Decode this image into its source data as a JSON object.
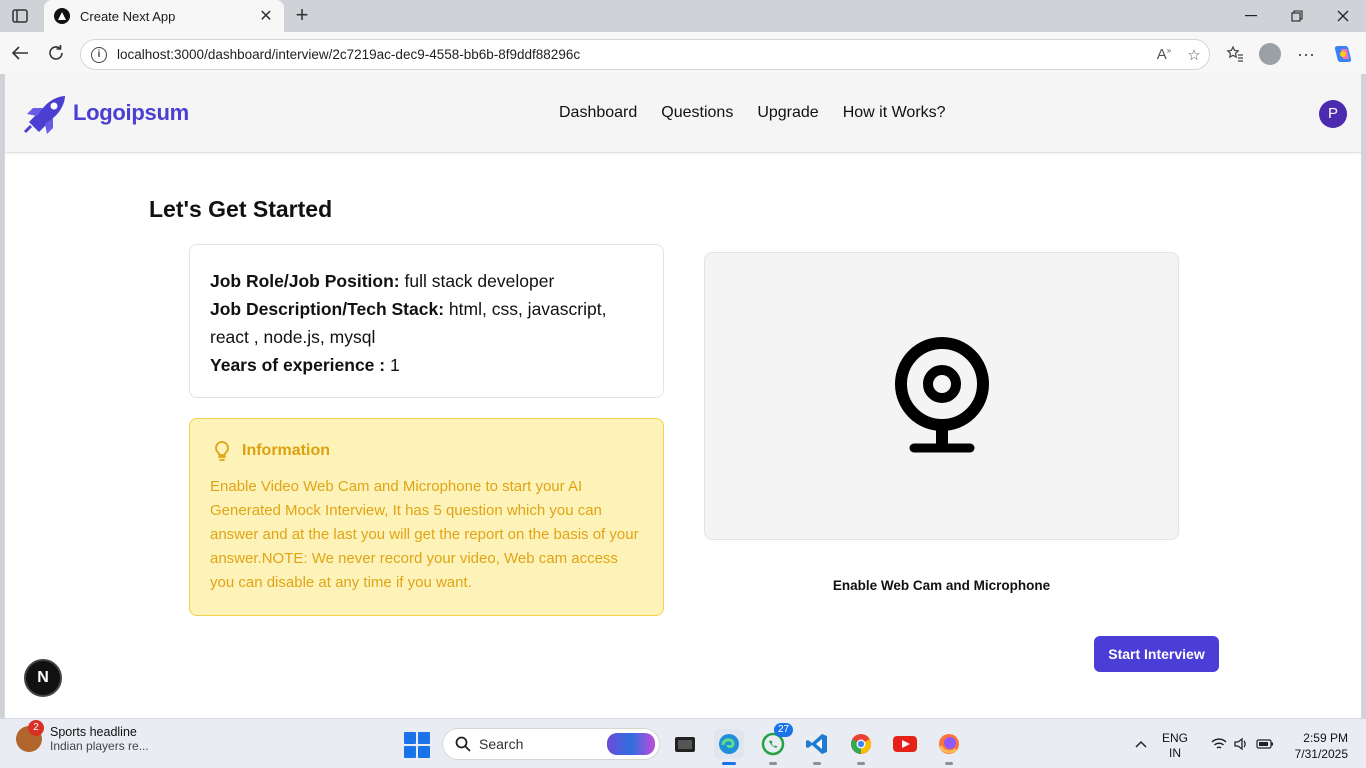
{
  "browser": {
    "tab_title": "Create Next App",
    "url": "localhost:3000/dashboard/interview/2c7219ac-dec9-4558-bb6b-8f9ddf88296c"
  },
  "header": {
    "logo_text": "Logoipsum",
    "nav": [
      "Dashboard",
      "Questions",
      "Upgrade",
      "How it Works?"
    ],
    "avatar_initial": "P"
  },
  "main": {
    "title": "Let's Get Started",
    "job": {
      "role_label": "Job Role/Job Position:",
      "role_value": "full stack developer",
      "desc_label": "Job Description/Tech Stack:",
      "desc_value": "html, css, javascript, react , node.js, mysql",
      "exp_label": "Years of experience :",
      "exp_value": "1"
    },
    "info": {
      "heading": "Information",
      "body": "Enable Video Web Cam and Microphone to start your AI Generated Mock Interview, It has 5 question which you can answer and at the last you will get the report on the basis of your answer.NOTE: We never record your video, Web cam access you can disable at any time if you want."
    },
    "webcam_label": "Enable Web Cam and Microphone",
    "start_button": "Start Interview",
    "next_badge": "N"
  },
  "taskbar": {
    "news_title": "Sports headline",
    "news_sub": "Indian players re...",
    "news_badge": "2",
    "search_label": "Search",
    "whatsapp_badge": "27",
    "lang_line1": "ENG",
    "lang_line2": "IN",
    "time": "2:59 PM",
    "date": "7/31/2025"
  },
  "colors": {
    "brand": "#4a3ed6",
    "info_bg": "#fdf3b8",
    "info_text": "#e0a416",
    "avatar": "#4c2bb0"
  }
}
